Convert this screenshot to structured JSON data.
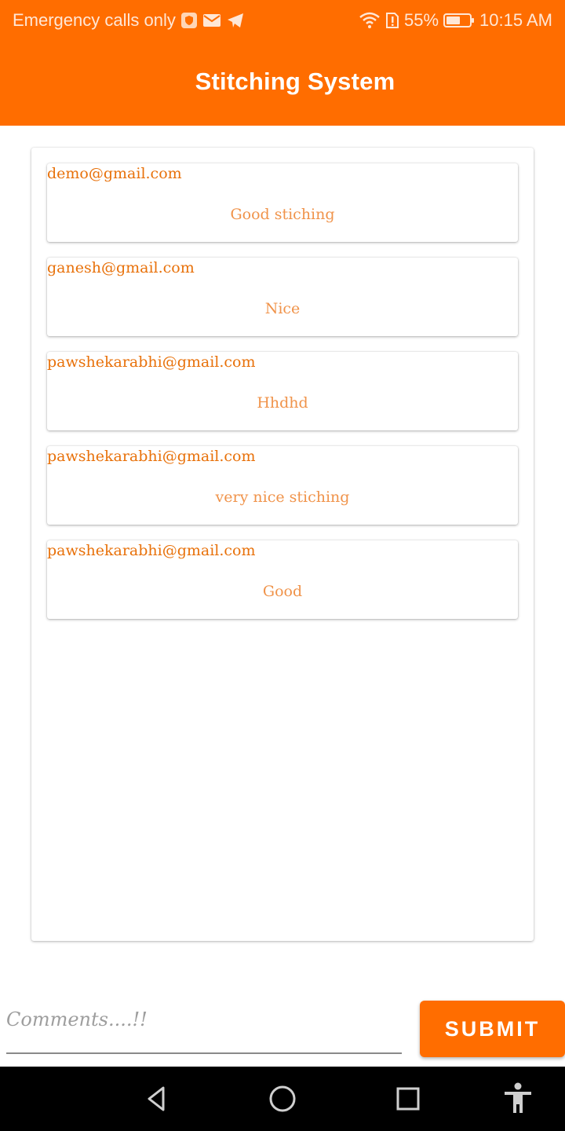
{
  "status_bar": {
    "carrier": "Emergency calls only",
    "battery_percent": "55%",
    "time": "10:15 AM",
    "icons": [
      "shield-icon",
      "mail-icon",
      "telegram-icon",
      "wifi-icon",
      "alert-sim-icon",
      "battery-icon"
    ]
  },
  "app_bar": {
    "title": "Stitching System"
  },
  "comments": [
    {
      "email": "demo@gmail.com",
      "text": "Good stiching"
    },
    {
      "email": "ganesh@gmail.com",
      "text": "Nice"
    },
    {
      "email": "pawshekarabhi@gmail.com",
      "text": "Hhdhd"
    },
    {
      "email": "pawshekarabhi@gmail.com",
      "text": "very nice stiching"
    },
    {
      "email": "pawshekarabhi@gmail.com",
      "text": "Good"
    }
  ],
  "comment_input": {
    "value": "",
    "placeholder": "Comments....!!"
  },
  "submit": {
    "label": "SUBMIT"
  },
  "nav_bar": {
    "buttons": [
      "back-icon",
      "home-icon",
      "recents-icon",
      "accessibility-icon"
    ]
  },
  "colors": {
    "primary": "#ff6d00",
    "email_text": "#e8710a",
    "comment_text": "#f0934a"
  }
}
